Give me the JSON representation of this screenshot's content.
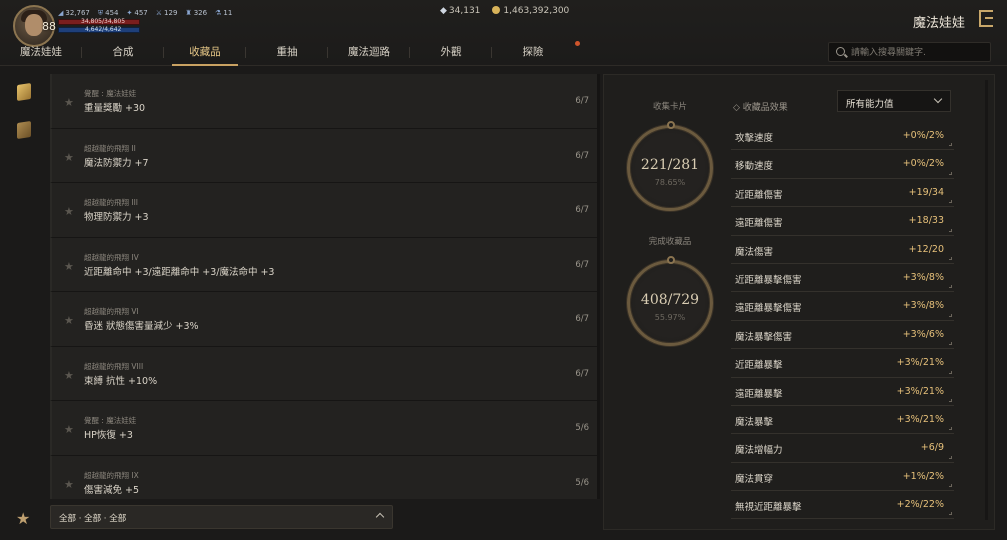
{
  "header": {
    "level": "88",
    "stats": [
      {
        "icon": "attack-icon",
        "value": "32,767"
      },
      {
        "icon": "defense-icon",
        "value": "454"
      },
      {
        "icon": "magic-icon",
        "value": "457"
      },
      {
        "icon": "sword-icon",
        "value": "129"
      },
      {
        "icon": "armor-icon",
        "value": "326"
      },
      {
        "icon": "potion-icon",
        "value": "11"
      }
    ],
    "hp": "34,805/34,805",
    "mp": "4,642/4,642",
    "currency": {
      "gems": "34,131",
      "gold": "1,463,392,300"
    },
    "title": "魔法娃娃"
  },
  "tabs": [
    "魔法娃娃",
    "合成",
    "收藏品",
    "重抽",
    "魔法迴路",
    "外觀",
    "探險"
  ],
  "active_tab_index": 2,
  "search": {
    "placeholder": "請輸入搜尋關鍵字."
  },
  "collection_items": [
    {
      "source": "覺醒 : 魔法娃娃",
      "bonus": "重量獎勵 +30",
      "count": "6/7"
    },
    {
      "source": "超越龍的飛翔 II",
      "bonus": "魔法防禦力 +7",
      "count": "6/7"
    },
    {
      "source": "超越龍的飛翔 III",
      "bonus": "物理防禦力 +3",
      "count": "6/7"
    },
    {
      "source": "超越龍的飛翔 IV",
      "bonus": "近距離命中 +3/遠距離命中 +3/魔法命中 +3",
      "count": "6/7"
    },
    {
      "source": "超越龍的飛翔 VI",
      "bonus": "昏迷 狀態傷害量減少 +3%",
      "count": "6/7"
    },
    {
      "source": "超越龍的飛翔 VIII",
      "bonus": "束縛 抗性 +10%",
      "count": "6/7"
    },
    {
      "source": "覺醒 : 魔法娃娃",
      "bonus": "HP恢復 +3",
      "count": "5/6"
    },
    {
      "source": "超越龍的飛翔 IX",
      "bonus": "傷害減免 +5",
      "count": "5/6"
    }
  ],
  "filter": {
    "label": "全部 · 全部 · 全部"
  },
  "collect_cards": {
    "label": "收集卡片",
    "value": "221/281",
    "percent": "78.65%"
  },
  "completed_items": {
    "label": "完成收藏品",
    "value": "408/729",
    "percent": "55.97%"
  },
  "effects_panel": {
    "label": "收藏品效果",
    "dropdown_value": "所有能力值",
    "rows": [
      {
        "name": "攻擊速度",
        "value": "+0%/2%"
      },
      {
        "name": "移動速度",
        "value": "+0%/2%"
      },
      {
        "name": "近距離傷害",
        "value": "+19/34"
      },
      {
        "name": "遠距離傷害",
        "value": "+18/33"
      },
      {
        "name": "魔法傷害",
        "value": "+12/20"
      },
      {
        "name": "近距離暴擊傷害",
        "value": "+3%/8%"
      },
      {
        "name": "遠距離暴擊傷害",
        "value": "+3%/8%"
      },
      {
        "name": "魔法暴擊傷害",
        "value": "+3%/6%"
      },
      {
        "name": "近距離暴擊",
        "value": "+3%/21%"
      },
      {
        "name": "遠距離暴擊",
        "value": "+3%/21%"
      },
      {
        "name": "魔法暴擊",
        "value": "+3%/21%"
      },
      {
        "name": "魔法增幅力",
        "value": "+6/9"
      },
      {
        "name": "魔法貫穿",
        "value": "+1%/2%"
      },
      {
        "name": "無視近距離暴擊",
        "value": "+2%/22%"
      }
    ]
  }
}
